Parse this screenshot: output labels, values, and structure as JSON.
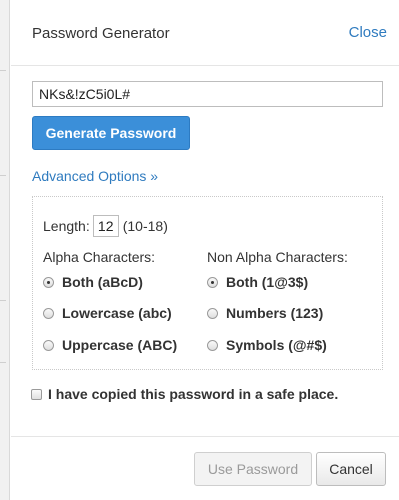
{
  "header": {
    "title": "Password Generator",
    "close_label": "Close"
  },
  "password": {
    "value": "NKs&!zC5i0L#"
  },
  "generate_label": "Generate Password",
  "advanced_label": "Advanced Options »",
  "length": {
    "label": "Length:",
    "value": "12",
    "range": "(10-18)"
  },
  "alpha": {
    "heading": "Alpha Characters:",
    "options": [
      {
        "label": "Both (aBcD)",
        "selected": true
      },
      {
        "label": "Lowercase (abc)",
        "selected": false
      },
      {
        "label": "Uppercase (ABC)",
        "selected": false
      }
    ]
  },
  "non_alpha": {
    "heading": "Non Alpha Characters:",
    "options": [
      {
        "label": "Both (1@3$)",
        "selected": true
      },
      {
        "label": "Numbers (123)",
        "selected": false
      },
      {
        "label": "Symbols (@#$)",
        "selected": false
      }
    ]
  },
  "confirm_label": "I have copied this password in a safe place.",
  "footer": {
    "use_label": "Use Password",
    "cancel_label": "Cancel"
  }
}
